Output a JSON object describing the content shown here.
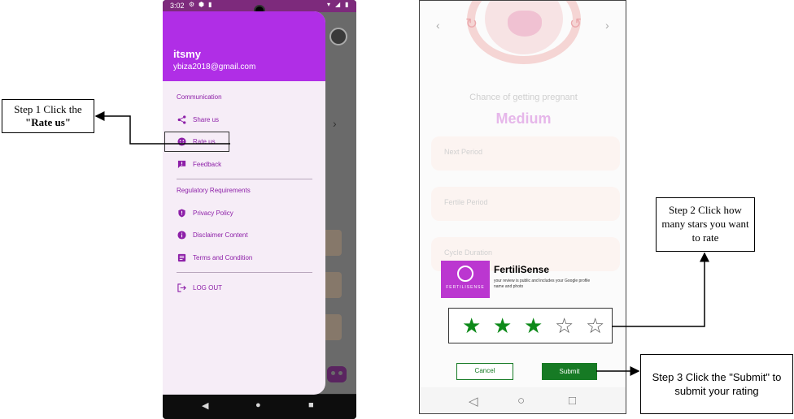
{
  "callouts": {
    "step1_line1": "Step 1 Click the",
    "step1_line2": "\"Rate us\"",
    "step2": "Step 2 Click how many stars you want to rate",
    "step3": "Step 3 Click the \"Submit\" to submit your rating"
  },
  "left_phone": {
    "status": {
      "time": "3:02"
    },
    "drawer": {
      "user_name": "itsmy",
      "user_email": "ybiza2018@gmail.com",
      "sections": [
        {
          "label": "Communication",
          "items": [
            {
              "label": "Share us",
              "icon": "share-icon"
            },
            {
              "label": "Rate us",
              "icon": "smiley-icon"
            },
            {
              "label": "Feedback",
              "icon": "feedback-icon"
            }
          ]
        },
        {
          "label": "Regulatory Requirements",
          "items": [
            {
              "label": "Privacy Policy",
              "icon": "shield-icon"
            },
            {
              "label": "Disclaimer Content",
              "icon": "info-icon"
            },
            {
              "label": "Terms and Condition",
              "icon": "document-icon"
            }
          ]
        }
      ],
      "logout_label": "LOG OUT"
    }
  },
  "right_phone": {
    "chance_label": "Chance of getting pregnant",
    "chance_value": "Medium",
    "fields": [
      "Next Period",
      "Fertile Period",
      "Cycle Duration"
    ],
    "rating_sheet": {
      "logo_text": "FERTILISENSE",
      "app_name": "FertiliSense",
      "note": "your review is public and includes your Google profile name and photo",
      "stars_total": 5,
      "stars_selected": 3,
      "star_filled_glyph": "★",
      "star_empty_glyph": "☆",
      "cancel_label": "Cancel",
      "submit_label": "Submit"
    }
  },
  "colors": {
    "drawer_header": "#b02ee6",
    "menu_text": "#8d1fa8",
    "star_green": "#0e8a1a",
    "button_green": "#167a24",
    "medium_text": "#e6b7ea"
  }
}
